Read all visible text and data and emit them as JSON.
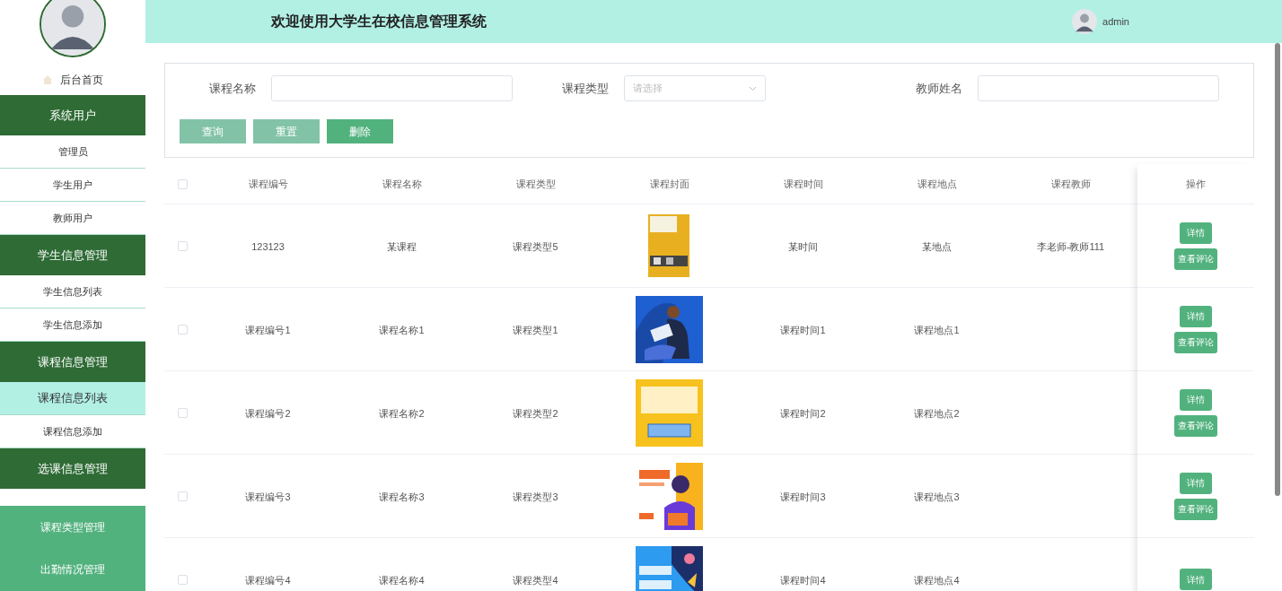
{
  "header": {
    "title": "欢迎使用大学生在校信息管理系统",
    "user": "admin"
  },
  "sidebar": {
    "home": "后台首页",
    "menu": [
      {
        "kind": "group",
        "label": "系统用户",
        "selected": false
      },
      {
        "kind": "item",
        "label": "管理员",
        "selected": false
      },
      {
        "kind": "item",
        "label": "学生用户",
        "selected": false
      },
      {
        "kind": "item",
        "label": "教师用户",
        "selected": false
      },
      {
        "kind": "group",
        "label": "学生信息管理",
        "selected": false
      },
      {
        "kind": "item",
        "label": "学生信息列表",
        "selected": false
      },
      {
        "kind": "item",
        "label": "学生信息添加",
        "selected": false
      },
      {
        "kind": "group",
        "label": "课程信息管理",
        "selected": false
      },
      {
        "kind": "item",
        "label": "课程信息列表",
        "selected": true
      },
      {
        "kind": "item",
        "label": "课程信息添加",
        "selected": false
      },
      {
        "kind": "group",
        "label": "选课信息管理",
        "selected": false
      }
    ],
    "footer_menu": [
      "课程类型管理",
      "出勤情况管理"
    ]
  },
  "search": {
    "fields": [
      {
        "kind": "input",
        "label": "课程名称"
      },
      {
        "kind": "select",
        "label": "课程类型",
        "placeholder": "请选择"
      },
      {
        "kind": "input",
        "label": "教师姓名"
      }
    ],
    "buttons": [
      {
        "kind": "light",
        "label": "查询"
      },
      {
        "kind": "light",
        "label": "重置"
      },
      {
        "kind": "solid",
        "label": "删除"
      }
    ]
  },
  "table": {
    "all_checked": false,
    "columns": [
      "课程编号",
      "课程名称",
      "课程类型",
      "课程封面",
      "课程时间",
      "课程地点",
      "课程教师",
      "操作"
    ],
    "rows": [
      {
        "checked": false,
        "cells": [
          "123123",
          "某课程",
          "课程类型5",
          "",
          "某时间",
          "某地点",
          "李老师-教师111"
        ],
        "actions": [
          "详情",
          "查看评论"
        ]
      },
      {
        "checked": false,
        "cells": [
          "课程编号1",
          "课程名称1",
          "课程类型1",
          "",
          "课程时间1",
          "课程地点1",
          ""
        ],
        "actions": [
          "详情",
          "查看评论"
        ]
      },
      {
        "checked": false,
        "cells": [
          "课程编号2",
          "课程名称2",
          "课程类型2",
          "",
          "课程时间2",
          "课程地点2",
          ""
        ],
        "actions": [
          "详情",
          "查看评论"
        ]
      },
      {
        "checked": false,
        "cells": [
          "课程编号3",
          "课程名称3",
          "课程类型3",
          "",
          "课程时间3",
          "课程地点3",
          ""
        ],
        "actions": [
          "详情",
          "查看评论"
        ]
      },
      {
        "checked": false,
        "cells": [
          "课程编号4",
          "课程名称4",
          "课程类型4",
          "",
          "课程时间4",
          "课程地点4",
          ""
        ],
        "actions": [
          "详情"
        ]
      }
    ]
  }
}
